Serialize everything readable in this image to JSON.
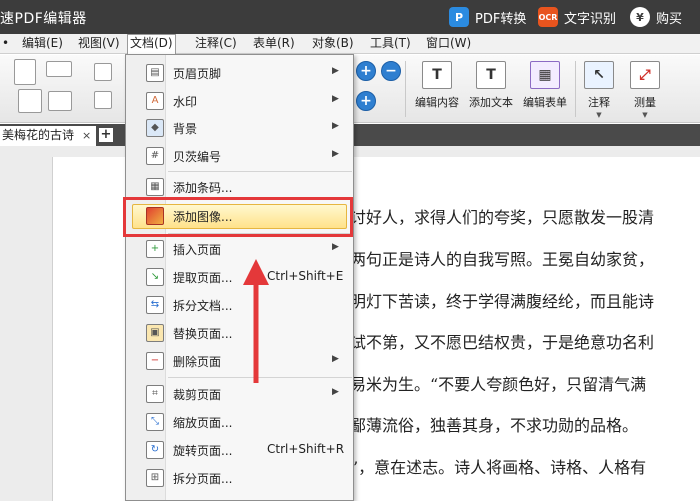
{
  "app": {
    "title": "速PDF编辑器"
  },
  "titlebar_actions": [
    {
      "label": "PDF转换",
      "icon": "pdf-convert-icon",
      "color": "#2b8be0"
    },
    {
      "label": "文字识别",
      "icon": "ocr-icon",
      "color": "#e8541e"
    },
    {
      "label": "购买",
      "icon": "yen-icon",
      "color": "#ffffff"
    }
  ],
  "menubar": [
    {
      "label": "编辑(E)"
    },
    {
      "label": "视图(V)"
    },
    {
      "label": "文档(D)",
      "active": true
    },
    {
      "label": "注释(C)"
    },
    {
      "label": "表单(R)"
    },
    {
      "label": "对象(B)"
    },
    {
      "label": "工具(T)"
    },
    {
      "label": "窗口(W)"
    }
  ],
  "toolbar": {
    "edit_content": "编辑内容",
    "add_text": "添加文本",
    "edit_form": "编辑表单",
    "annotate": "注释",
    "measure": "测量"
  },
  "tab": {
    "title": "美梅花的古诗",
    "close": "×",
    "add": "+"
  },
  "dropdown": {
    "items": [
      {
        "label": "页眉页脚",
        "icon": "header-footer-icon",
        "submenu": true
      },
      {
        "label": "水印",
        "icon": "watermark-icon",
        "submenu": true
      },
      {
        "label": "背景",
        "icon": "background-icon",
        "submenu": true
      },
      {
        "label": "贝茨编号",
        "icon": "bates-number-icon",
        "submenu": true
      },
      {
        "label": "添加条码...",
        "icon": "barcode-icon"
      },
      {
        "label": "添加图像...",
        "icon": "add-image-icon",
        "highlighted": true
      },
      {
        "label": "插入页面",
        "icon": "insert-page-icon",
        "submenu": true
      },
      {
        "label": "提取页面...",
        "icon": "extract-page-icon",
        "shortcut": "Ctrl+Shift+E"
      },
      {
        "label": "拆分文档...",
        "icon": "split-document-icon"
      },
      {
        "label": "替换页面...",
        "icon": "replace-page-icon"
      },
      {
        "label": "删除页面",
        "icon": "delete-page-icon",
        "submenu": true
      },
      {
        "label": "裁剪页面",
        "icon": "crop-page-icon",
        "submenu": true
      },
      {
        "label": "缩放页面...",
        "icon": "scale-page-icon"
      },
      {
        "label": "旋转页面...",
        "icon": "rotate-page-icon",
        "shortcut": "Ctrl+Shift+R"
      },
      {
        "label": "拆分页面...",
        "icon": "split-page-icon"
      }
    ]
  },
  "document": {
    "lines": [
      "讨好人，求得人们的夸奖，只愿散发一股清",
      "两句正是诗人的自我写照。王冕自幼家贫，",
      "明灯下苦读，终于学得满腹经纶，而且能诗",
      "试不第，又不愿巴结权贵，于是绝意功名利",
      "易米为生。“不要人夸颜色好，只留清气满",
      "鄙薄流俗，独善其身，不求功勋的品格。",
      "”，意在述志。诗人将画格、诗格、人格有"
    ]
  },
  "colors": {
    "titlebar": "#3c3c3c",
    "highlight": "#ffe28a",
    "annotation": "#e4383a"
  }
}
